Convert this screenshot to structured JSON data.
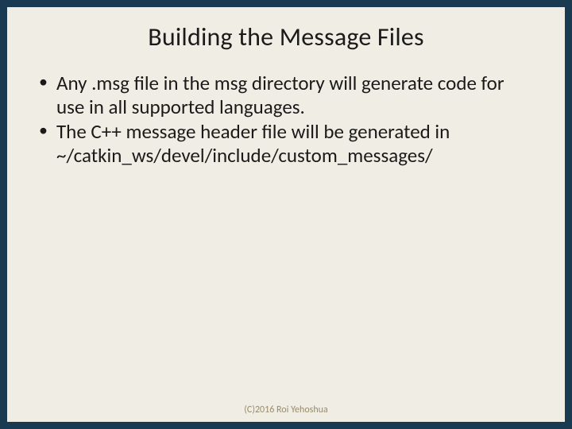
{
  "slide": {
    "title": "Building the Message Files",
    "bullets": [
      "Any .msg file in the msg directory will generate code for use in all supported languages.",
      "The C++ message header file will be generated in ~/catkin_ws/devel/include/custom_messages/"
    ],
    "footer": "(C)2016 Roi Yehoshua"
  }
}
